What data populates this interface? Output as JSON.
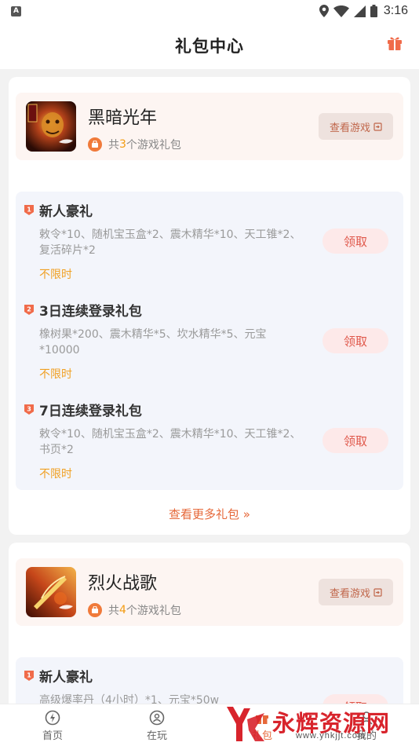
{
  "status_bar": {
    "time": "3:16",
    "notification_icon_letter": "A"
  },
  "header": {
    "title": "礼包中心"
  },
  "games": [
    {
      "name": "黑暗光年",
      "gift_count_prefix": "共",
      "gift_count": "3",
      "gift_count_suffix": "个游戏礼包",
      "view_game_label": "查看游戏",
      "gifts": [
        {
          "rank": "1",
          "name": "新人豪礼",
          "desc": "敕令*10、随机宝玉盒*2、震木精华*10、天工锥*2、复活碎片*2",
          "validity": "不限时",
          "claim_label": "领取"
        },
        {
          "rank": "2",
          "name": "3日连续登录礼包",
          "desc": "橡树果*200、震木精华*5、坎水精华*5、元宝*10000",
          "validity": "不限时",
          "claim_label": "领取"
        },
        {
          "rank": "3",
          "name": "7日连续登录礼包",
          "desc": "敕令*10、随机宝玉盒*2、震木精华*10、天工锥*2、书页*2",
          "validity": "不限时",
          "claim_label": "领取"
        }
      ],
      "more_label": "查看更多礼包 »"
    },
    {
      "name": "烈火战歌",
      "gift_count_prefix": "共",
      "gift_count": "4",
      "gift_count_suffix": "个游戏礼包",
      "view_game_label": "查看游戏",
      "gifts": [
        {
          "rank": "1",
          "name": "新人豪礼",
          "desc": "高级爆率丹（4小时）*1、元宝*50w",
          "validity": "",
          "claim_label": "领取"
        }
      ]
    }
  ],
  "bottom_nav": [
    {
      "label": "首页",
      "icon": "home-icon",
      "active": false
    },
    {
      "label": "在玩",
      "icon": "playing-icon",
      "active": false
    },
    {
      "label": "礼包",
      "icon": "gift-icon",
      "active": true
    },
    {
      "label": "我的",
      "icon": "profile-icon",
      "active": false
    }
  ],
  "watermark": {
    "text": "永辉资源网",
    "url": "www.yhkjjt.com"
  },
  "colors": {
    "accent": "#e6683a",
    "claim_text": "#e0584b",
    "validity": "#f0a023",
    "count": "#f39c12"
  }
}
